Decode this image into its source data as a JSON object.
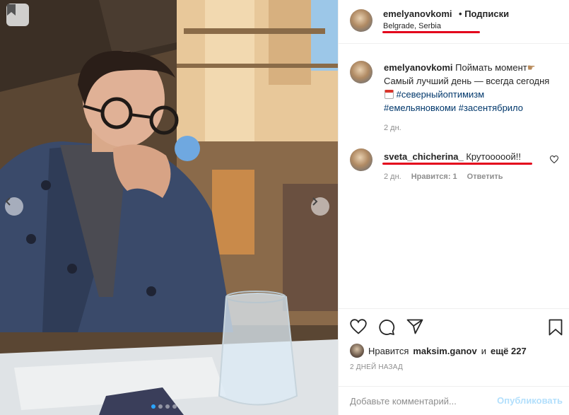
{
  "post": {
    "author": "emelyanovkomi",
    "follow_separator": "•",
    "follow_label": "Подписки",
    "location": "Belgrade, Serbia"
  },
  "caption": {
    "user": "emelyanovkomi",
    "text1": "Поймать момент",
    "text2": "Самый лучший день — всегда сегодня",
    "hashtags": [
      "#северныйоптимизм",
      "#емельяновкоми",
      "#засентябрило"
    ],
    "time": "2 дн."
  },
  "comments": [
    {
      "user": "sveta_chicherina_",
      "text": "Крутооооой!!",
      "time": "2 дн.",
      "likes": "Нравится: 1",
      "reply": "Ответить"
    }
  ],
  "likes": {
    "prefix": "Нравится",
    "user": "maksim.ganov",
    "conjunction": "и",
    "others": "ещё 227"
  },
  "date_label": "2 ДНЕЙ НАЗАД",
  "add_comment": {
    "placeholder": "Добавьте комментарий...",
    "publish_label": "Опубликовать"
  },
  "icons": {
    "save_badge": "bookmark-icon",
    "prev": "chevron-left-icon",
    "next": "chevron-right-icon",
    "like": "heart-icon",
    "comment": "comment-icon",
    "share": "share-icon",
    "save": "bookmark-icon"
  },
  "colors": {
    "accent_blue": "#00376b",
    "publish_disabled": "#b2dffc",
    "annotation_red": "#e3001b",
    "carousel_active": "#2aa5ff"
  },
  "carousel": {
    "count": 4,
    "active_index": 0
  }
}
